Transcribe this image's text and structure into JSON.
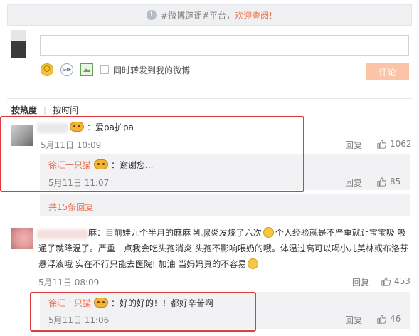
{
  "notice": {
    "prefix": "#微博辟谣#平台，",
    "link": "欢迎查阅!"
  },
  "composer": {
    "placeholder": "",
    "sync_label": "同时转发到我的微博",
    "submit_label": "评论"
  },
  "sort": {
    "hot": "按热度",
    "time": "按时间"
  },
  "comments": [
    {
      "text": "：爱pa护pa",
      "time": "5月11日 10:09",
      "reply_label": "回复",
      "likes": "1062",
      "sub_reply": {
        "user": "徐汇一只猫",
        "text": "：谢谢您...",
        "time": "5月11日 11:07",
        "reply_label": "回复",
        "likes": "85"
      },
      "more": "共15条回复"
    },
    {
      "name_tail": "麻：",
      "text_1": "目前娃九个半月的麻麻 乳腺炎发烧了六次",
      "text_2": "个人经验就是不严重就让宝宝吸 吸",
      "line_2": "通了就降温了。严重一点我会吃头孢消炎 头孢不影响喂奶的哦。体温过高可以喝小儿美林或布洛芬",
      "line_3": "悬浮液哦 实在不行只能去医院! 加油 当妈妈真的不容易",
      "time": "5月11日 08:09",
      "reply_label": "回复",
      "likes": "453",
      "sub_reply": {
        "user": "徐汇一只猫",
        "text": "：好的好的！！都好辛苦啊",
        "time": "5月11日 11:06",
        "reply_label": "回复",
        "likes": "46"
      }
    }
  ],
  "colors": {
    "accent": "#eb7350",
    "highlight": "#e0393e",
    "reply_bg": "#f2f2f5"
  },
  "icons": [
    "info-icon",
    "smile-icon",
    "gif-icon",
    "image-icon",
    "emoji-icon",
    "thumb-up-icon"
  ]
}
